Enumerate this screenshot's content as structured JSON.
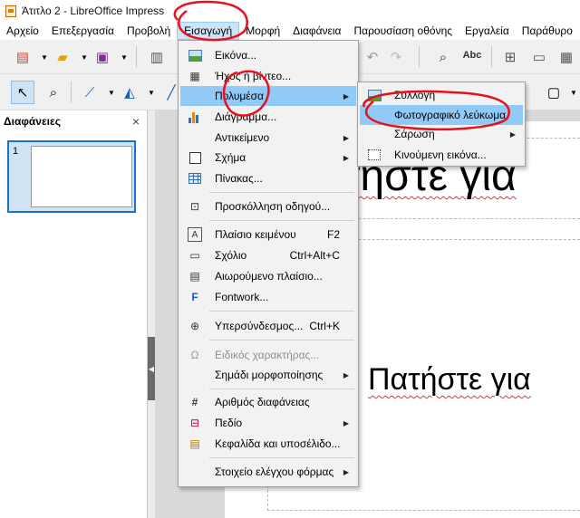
{
  "window": {
    "title": "Άτιτλο 2 - LibreOffice Impress"
  },
  "menubar": [
    "Αρχείο",
    "Επεξεργασία",
    "Προβολή",
    "Εισαγωγή",
    "Μορφή",
    "Διαφάνεια",
    "Παρουσίαση οθόνης",
    "Εργαλεία",
    "Παράθυρο"
  ],
  "slides_pane": {
    "title": "Διαφάνειες",
    "close": "×",
    "slide_number": "1"
  },
  "slide": {
    "title_placeholder": "Πατήστε για",
    "body_placeholder": "Πατήστε για"
  },
  "insert_menu": [
    {
      "label": "Εικόνα...",
      "icon": "image-icon"
    },
    {
      "label": "Ήχος ή βίντεο...",
      "icon": "film-icon"
    },
    {
      "label": "Πολυμέσα",
      "icon": "",
      "submenu": true,
      "highlighted": true
    },
    {
      "label": "Διάγραμμα...",
      "icon": "chart-icon"
    },
    {
      "label": "Αντικείμενο",
      "icon": "",
      "submenu": true
    },
    {
      "label": "Σχήμα",
      "icon": "shape-icon",
      "submenu": true
    },
    {
      "label": "Πίνακας...",
      "icon": "table-icon"
    },
    {
      "label": "Προσκόλληση οδηγού...",
      "icon": "snap-guide-icon"
    },
    {
      "label": "Πλαίσιο κειμένου",
      "icon": "text-box-icon",
      "shortcut": "F2"
    },
    {
      "label": "Σχόλιο",
      "icon": "comment-icon",
      "shortcut": "Ctrl+Alt+C"
    },
    {
      "label": "Αιωρούμενο πλαίσιο...",
      "icon": "floating-frame-icon"
    },
    {
      "label": "Fontwork...",
      "icon": "fontwork-icon"
    },
    {
      "label": "Υπερσύνδεσμος...",
      "icon": "hyperlink-icon",
      "shortcut": "Ctrl+K"
    },
    {
      "label": "Ειδικός χαρακτήρας...",
      "icon": "omega-icon",
      "disabled": true
    },
    {
      "label": "Σημάδι μορφοποίησης",
      "icon": "",
      "submenu": true
    },
    {
      "label": "Αριθμός διαφάνειας",
      "icon": "slide-number-icon"
    },
    {
      "label": "Πεδίο",
      "icon": "field-icon",
      "submenu": true
    },
    {
      "label": "Κεφαλίδα και υποσέλιδο...",
      "icon": "header-footer-icon"
    },
    {
      "label": "Στοιχείο ελέγχου φόρμας",
      "icon": "",
      "submenu": true
    }
  ],
  "media_submenu": [
    {
      "label": "Συλλογή",
      "icon": "gallery-icon"
    },
    {
      "label": "Φωτογραφικό λεύκωμα",
      "icon": "",
      "highlighted": true
    },
    {
      "label": "Σάρωση",
      "icon": "",
      "submenu": true
    },
    {
      "label": "Κινούμενη εικόνα...",
      "icon": "animated-image-icon"
    }
  ],
  "colors": {
    "menu_highlight": "#91c9f7",
    "annotation": "#e8101a",
    "selection": "#1a73c8"
  }
}
